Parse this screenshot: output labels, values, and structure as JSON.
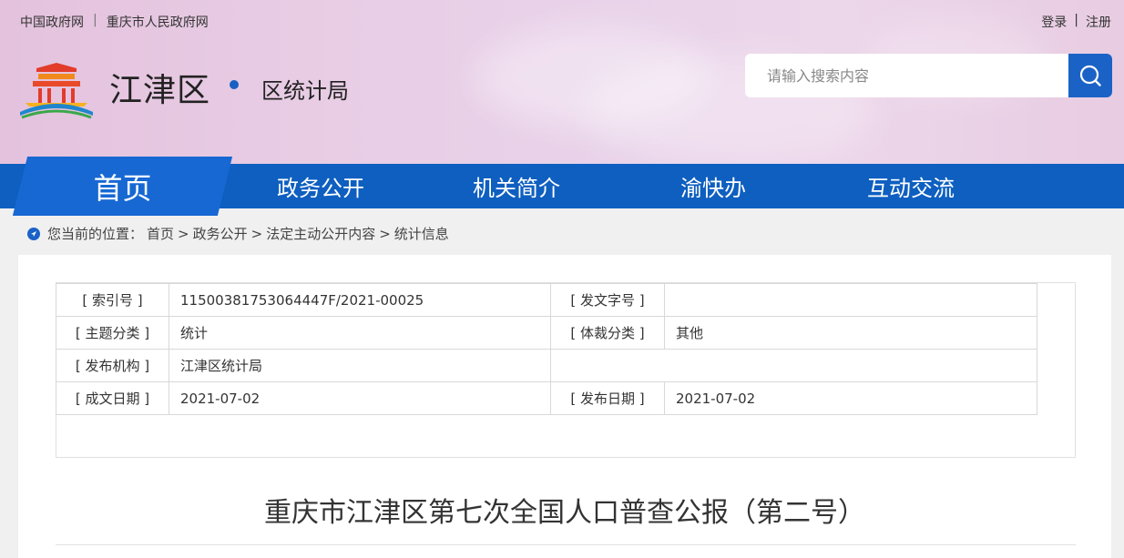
{
  "header": {
    "top_links": [
      "中国政府网",
      "重庆市人民政府网"
    ],
    "top_sep": "|",
    "login": "登录",
    "register": "注册",
    "login_sep": "|",
    "site_name": "江津区",
    "sub_name": "区统计局",
    "search_placeholder": "请输入搜索内容"
  },
  "nav": {
    "home": "首页",
    "items": [
      "政务公开",
      "机关简介",
      "渝快办",
      "互动交流"
    ]
  },
  "breadcrumb": {
    "prefix": "您当前的位置：",
    "path": [
      "首页",
      "政务公开",
      "法定主动公开内容",
      "统计信息"
    ],
    "sep": ">"
  },
  "meta": {
    "index_label": "[ 索引号 ]",
    "index_value": "11500381753064447F/2021-00025",
    "docno_label": "[ 发文字号 ]",
    "docno_value": "",
    "topic_label": "[ 主题分类 ]",
    "topic_value": "统计",
    "genre_label": "[ 体裁分类 ]",
    "genre_value": "其他",
    "org_label": "[ 发布机构 ]",
    "org_value": "江津区统计局",
    "created_label": "[ 成文日期 ]",
    "created_value": "2021-07-02",
    "published_label": "[ 发布日期 ]",
    "published_value": "2021-07-02"
  },
  "article": {
    "title": "重庆市江津区第七次全国人口普查公报（第二号）"
  },
  "colors": {
    "nav_blue": "#0e5fc0",
    "home_tab": "#1768d3",
    "search_button": "#1b62c6"
  }
}
